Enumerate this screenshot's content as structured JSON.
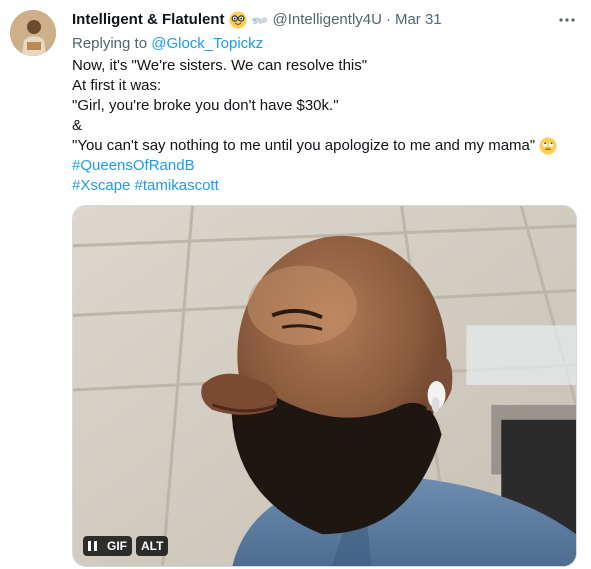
{
  "author": {
    "display_name": "Intelligent & Flatulent",
    "emoji_1": "nerd-face-icon",
    "emoji_2": "dash-icon",
    "handle": "@Intelligently4U",
    "separator": "·",
    "timestamp": "Mar 31"
  },
  "reply": {
    "prefix": "Replying to",
    "target": "@Glock_Topickz"
  },
  "body": {
    "line_1": "Now, it's \"We're sisters. We can resolve this\"",
    "line_2": "At first it was:",
    "line_3": "\"Girl, you're broke you don't have $30k.\"",
    "line_4": "&",
    "line_5": "\"You can't say nothing to me until you apologize to me and my mama\"",
    "line_5_emoji": "eye-roll-face-icon",
    "hashtag_1": "#QueensOfRandB",
    "hashtag_2": "#Xscape",
    "hashtag_3": "#tamikascott"
  },
  "media": {
    "type": "gif",
    "pause_label": "",
    "gif_label": "GIF",
    "alt_label": "ALT"
  },
  "colors": {
    "link": "#1d9bf0",
    "secondary_text": "#536471",
    "primary_text": "#0f1419"
  }
}
